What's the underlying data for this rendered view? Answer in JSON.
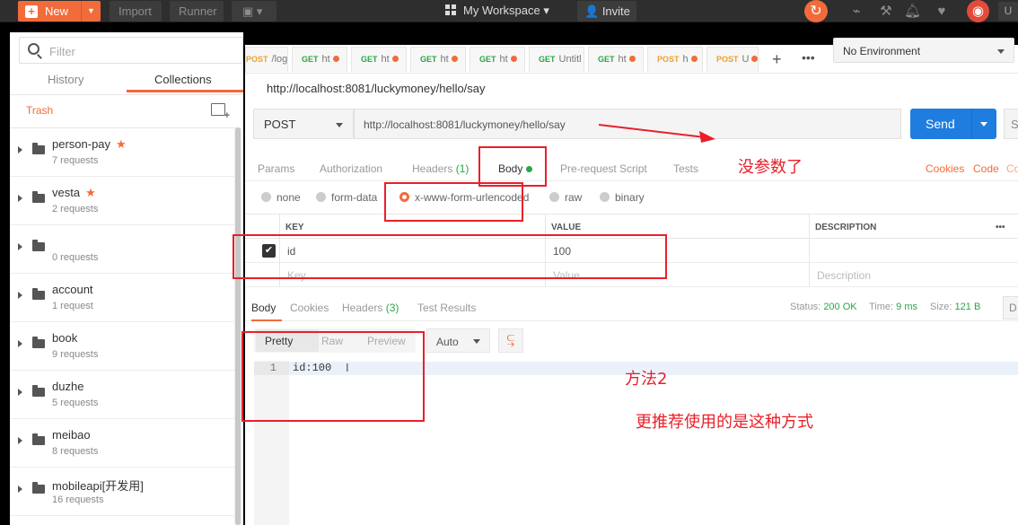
{
  "topbar": {
    "new_label": "New",
    "import_label": "Import",
    "runner_label": "Runner",
    "workspace_label": "My Workspace",
    "invite_label": "Invite",
    "user_initial": "U"
  },
  "sidebar": {
    "filter_placeholder": "Filter",
    "tabs": [
      "History",
      "Collections"
    ],
    "active_tab": "Collections",
    "trash_label": "Trash",
    "collections": [
      {
        "name": "person-pay",
        "requests": "7 requests",
        "starred": true
      },
      {
        "name": "vesta",
        "requests": "2 requests",
        "starred": true
      },
      {
        "name": "",
        "requests": "0 requests",
        "starred": false
      },
      {
        "name": "account",
        "requests": "1 request",
        "starred": false
      },
      {
        "name": "book",
        "requests": "9 requests",
        "starred": false
      },
      {
        "name": "duzhe",
        "requests": "5 requests",
        "starred": false
      },
      {
        "name": "meibao",
        "requests": "8 requests",
        "starred": false
      },
      {
        "name": "mobileapi[开发用]",
        "requests": "16 requests",
        "starred": false
      }
    ]
  },
  "request_tabs": [
    {
      "method": "POST",
      "name": "/logi"
    },
    {
      "method": "GET",
      "name": "ht"
    },
    {
      "method": "GET",
      "name": "ht"
    },
    {
      "method": "GET",
      "name": "ht"
    },
    {
      "method": "GET",
      "name": "ht"
    },
    {
      "method": "GET",
      "name": "Untitl"
    },
    {
      "method": "GET",
      "name": "ht"
    },
    {
      "method": "POST",
      "name": "h"
    },
    {
      "method": "POST",
      "name": "U"
    }
  ],
  "environment": "No Environment",
  "request": {
    "title": "http://localhost:8081/luckymoney/hello/say",
    "method": "POST",
    "url": "http://localhost:8081/luckymoney/hello/say",
    "send_label": "Send",
    "save_label": "S",
    "tabs": [
      "Params",
      "Authorization",
      "Headers",
      "Body",
      "Pre-request Script",
      "Tests"
    ],
    "headers_count": "(1)",
    "right_links": [
      "Cookies",
      "Code",
      "Co"
    ],
    "body_modes": [
      "none",
      "form-data",
      "x-www-form-urlencoded",
      "raw",
      "binary"
    ],
    "selected_mode": "x-www-form-urlencoded",
    "columns": [
      "KEY",
      "VALUE",
      "DESCRIPTION"
    ],
    "rows": [
      {
        "key": "id",
        "value": "100",
        "checked": true
      }
    ],
    "placeholder": {
      "key": "Key",
      "value": "Value",
      "description": "Description"
    }
  },
  "response": {
    "tabs": [
      "Body",
      "Cookies",
      "Headers",
      "Test Results"
    ],
    "headers_count": "(3)",
    "status_label": "Status:",
    "status_value": "200 OK",
    "time_label": "Time:",
    "time_value": "9 ms",
    "size_label": "Size:",
    "size_value": "121 B",
    "download_label": "D",
    "view_modes": [
      "Pretty",
      "Raw",
      "Preview"
    ],
    "format": "Auto",
    "line_number": "1",
    "body": "id:100"
  },
  "annotations": {
    "note1": "没参数了",
    "note2": "方法2",
    "note3": "更推荐使用的是这种方式"
  },
  "colors": {
    "accent": "#f26b3a",
    "send": "#1f7de0",
    "annotation": "#e8202a",
    "success": "#28a745"
  }
}
